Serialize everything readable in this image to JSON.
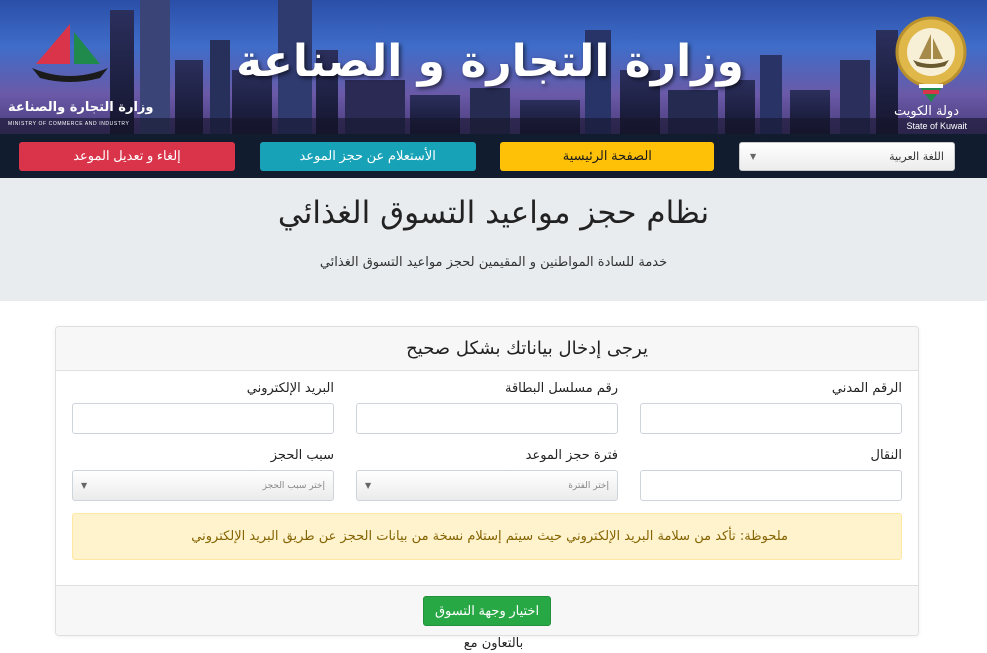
{
  "banner": {
    "title": "وزارة التجارة و الصناعة",
    "state_ar": "دولة الكويت",
    "state_en": "State of Kuwait",
    "ministry_ar": "وزارة التجارة والصناعة",
    "ministry_en": "MINISTRY OF COMMERCE AND INDUSTRY"
  },
  "nav": {
    "cancel_label": "إلغاء و تعديل الموعد",
    "inquiry_label": "الأستعلام عن حجز الموعد",
    "home_label": "الصفحة الرئيسية",
    "language_selected": "اللغة العربية"
  },
  "hero": {
    "title": "نظام حجز مواعيد التسوق الغذائي",
    "subtitle": "خدمة للسادة المواطنين و المقيمين لحجز مواعيد التسوق الغذائي"
  },
  "form": {
    "header": "يرجى إدخال بياناتك بشكل صحيح",
    "civil_id_label": "الرقم المدني",
    "card_serial_label": "رقم مسلسل البطاقة",
    "email_label": "البريد الإلكتروني",
    "mobile_label": "النقال",
    "period_label": "فترة حجز الموعد",
    "period_placeholder": "إختر الفترة",
    "reason_label": "سبب الحجز",
    "reason_placeholder": "إختر سبب الحجز",
    "note": "ملحوظة: تأكد من سلامة البريد الإلكتروني حيث سيتم إستلام نسخة من بيانات الحجز عن طريق البريد الإلكتروني",
    "submit_label": "اختيار وجهة التسوق"
  },
  "footer": {
    "cooperation": "بالتعاون مع"
  },
  "colors": {
    "nav_bg": "#111c2e",
    "red": "#d9344a",
    "teal": "#17a2b8",
    "yellow": "#ffc107",
    "green": "#28a745"
  }
}
